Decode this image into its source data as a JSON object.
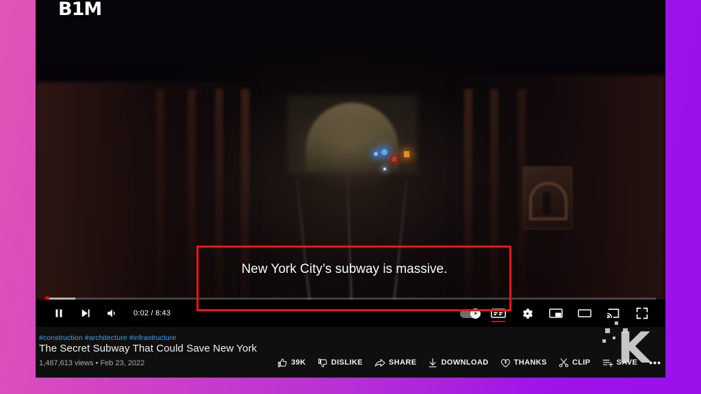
{
  "frame": {
    "gradient_start": "#e155b4",
    "gradient_end": "#9a10ea"
  },
  "video": {
    "channel_logo": "B1M",
    "caption_text": "New York City’s subway is massive.",
    "scene_description": "dark subway tunnel with approaching train lights"
  },
  "annotation": {
    "color": "#f11414",
    "shape": "rectangle"
  },
  "player": {
    "pause_icon": "pause-icon",
    "next_icon": "next-video-icon",
    "volume_icon": "volume-icon",
    "time_display": "0:02 / 8:43",
    "current_time": "0:02",
    "duration": "8:43",
    "autoplay_label": "autoplay-toggle",
    "autoplay_on": true,
    "subtitles_label": "CC",
    "subtitles_active": true,
    "subtitles_indicator_color": "#ff0000",
    "settings_icon": "gear-icon",
    "miniplayer_icon": "miniplayer-icon",
    "theater_icon": "theater-mode-icon",
    "cast_icon": "cast-icon",
    "fullscreen_icon": "fullscreen-icon",
    "progress_percent": 0.4,
    "buffer_percent": 5
  },
  "meta": {
    "hashtags": "#construction #architecture #infrastructure",
    "title": "The Secret Subway That Could Save New York",
    "stats": "1,487,613 views • Feb 23, 2022",
    "views": "1,487,613 views",
    "upload_date": "Feb 23, 2022",
    "link_color": "#3ea6ff"
  },
  "actions": [
    {
      "name": "like",
      "label": "39K",
      "icon": "thumbs-up-icon"
    },
    {
      "name": "dislike",
      "label": "DISLIKE",
      "icon": "thumbs-down-icon"
    },
    {
      "name": "share",
      "label": "SHARE",
      "icon": "share-arrow-icon"
    },
    {
      "name": "download",
      "label": "DOWNLOAD",
      "icon": "download-icon"
    },
    {
      "name": "thanks",
      "label": "THANKS",
      "icon": "thanks-heart-dollar-icon"
    },
    {
      "name": "clip",
      "label": "CLIP",
      "icon": "scissors-icon"
    },
    {
      "name": "save",
      "label": "SAVE",
      "icon": "save-playlist-icon"
    }
  ],
  "more_button": {
    "label": "•••"
  },
  "watermark": {
    "letter": "K"
  }
}
